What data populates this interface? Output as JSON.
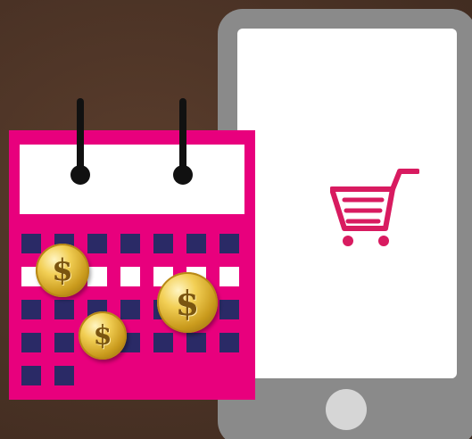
{
  "scene": {
    "colors": {
      "background": "#4b3326",
      "phone_body": "#8a8a8a",
      "phone_screen": "#ffffff",
      "calendar": "#e8007d",
      "calendar_cells": "#2a2a66",
      "cart": "#d81b60",
      "coin": "#e0b43a"
    },
    "icons": {
      "cart": "shopping-cart-icon",
      "coin": "dollar-coin-icon",
      "calendar": "calendar-icon",
      "phone": "smartphone-icon"
    },
    "coin_symbol": "$"
  }
}
